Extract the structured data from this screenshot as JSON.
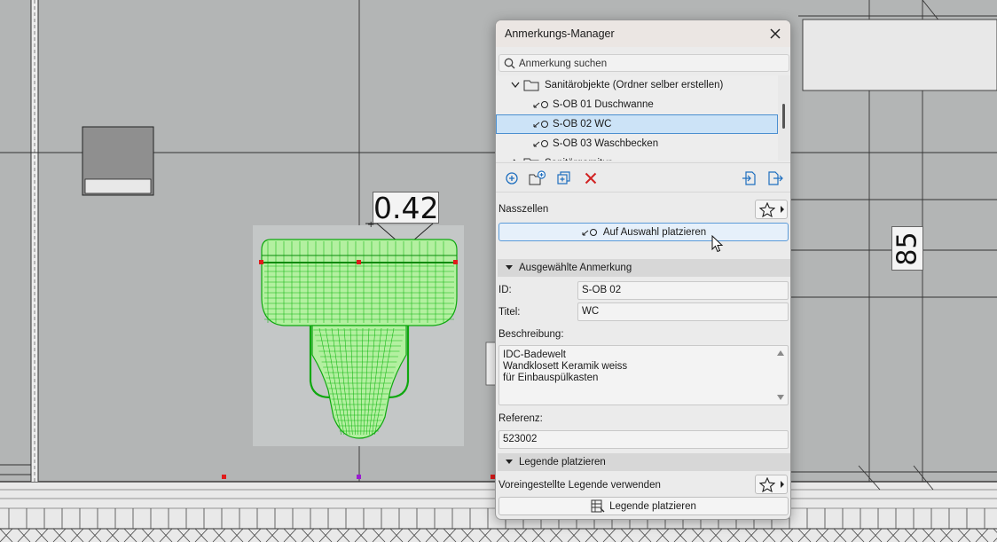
{
  "canvas": {
    "dimension_top": "0.42",
    "dimension_right": "85"
  },
  "palette": {
    "title": "Anmerkungs-Manager",
    "search": {
      "placeholder": "Anmerkung suchen",
      "value": ""
    },
    "tree": [
      {
        "type": "folder",
        "label": "Sanitärobjekte (Ordner selber erstellen)",
        "expanded": true
      },
      {
        "type": "item",
        "label": "S-OB 01 Duschwanne",
        "selected": false
      },
      {
        "type": "item",
        "label": "S-OB 02 WC",
        "selected": true
      },
      {
        "type": "item",
        "label": "S-OB 03 Waschbecken",
        "selected": false
      },
      {
        "type": "folder",
        "label": "Sanitärgarnitur",
        "expanded": false
      }
    ],
    "toolbar_icons": [
      "add-note-icon",
      "new-folder-icon",
      "duplicate-icon",
      "delete-icon",
      "import-icon",
      "export-icon"
    ],
    "favorites_label": "Nasszellen",
    "place_on_selection": "Auf Auswahl platzieren",
    "selected_section": {
      "header": "Ausgewählte Anmerkung",
      "id_label": "ID:",
      "id_value": "S-OB 02",
      "title_label": "Titel:",
      "title_value": "WC",
      "description_label": "Beschreibung:",
      "description_lines": [
        "IDC-Badewelt",
        "Wandklosett Keramik weiss",
        "für Einbauspülkasten"
      ],
      "reference_label": "Referenz:",
      "reference_value": "523002"
    },
    "legend_section": {
      "header": "Legende platzieren",
      "default_legend_label": "Voreingestellte Legende verwenden",
      "place_legend_button": "Legende platzieren"
    },
    "colors": {
      "selection": "#cce3f7",
      "selection_border": "#4b8fd0",
      "delete": "#d12222",
      "icon_blue": "#1f6fbf"
    }
  }
}
